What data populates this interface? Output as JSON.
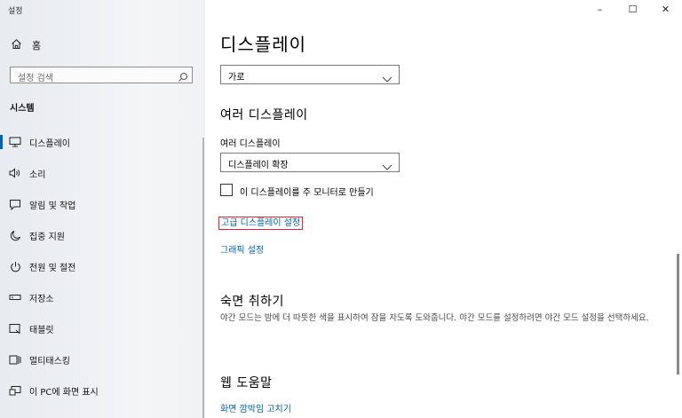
{
  "window": {
    "title": "설정",
    "controls": {
      "minimize": "–",
      "maximize": "☐",
      "close": "✕"
    }
  },
  "sidebar": {
    "home_label": "홈",
    "search_placeholder": "설정 검색",
    "section_title": "시스템",
    "items": [
      {
        "label": "디스플레이",
        "icon": "monitor-icon",
        "active": true
      },
      {
        "label": "소리",
        "icon": "speaker-icon",
        "active": false
      },
      {
        "label": "알림 및 작업",
        "icon": "notification-icon",
        "active": false
      },
      {
        "label": "집중 지원",
        "icon": "moon-icon",
        "active": false
      },
      {
        "label": "전원 및 절전",
        "icon": "power-icon",
        "active": false
      },
      {
        "label": "저장소",
        "icon": "storage-icon",
        "active": false
      },
      {
        "label": "태블릿",
        "icon": "tablet-icon",
        "active": false
      },
      {
        "label": "멀티태스킹",
        "icon": "multitask-icon",
        "active": false
      },
      {
        "label": "이 PC에 화면 표시",
        "icon": "project-icon",
        "active": false
      }
    ]
  },
  "main": {
    "title": "디스플레이",
    "orientation": {
      "value": "가로"
    },
    "multiple_displays": {
      "heading": "여러 디스플레이",
      "label": "여러 디스플레이",
      "value": "디스플레이 확장",
      "checkbox_label": "이 디스플레이를 주 모니터로 만들기",
      "checkbox_checked": false
    },
    "links": {
      "advanced": "고급 디스플레이 설정",
      "graphics": "그래픽 설정"
    },
    "sleep": {
      "heading": "숙면 취하기",
      "description": "야간 모드는 밤에 더 따뜻한 색을 표시하여 잠을 자도록 도와줍니다. 야간 모드를 설정하려면 야간 모드 설정을 선택하세요."
    },
    "help": {
      "heading": "웹 도움말",
      "link": "화면 깜박임 고치기"
    }
  },
  "colors": {
    "accent": "#0063b1",
    "highlight_border": "#e0242f"
  }
}
